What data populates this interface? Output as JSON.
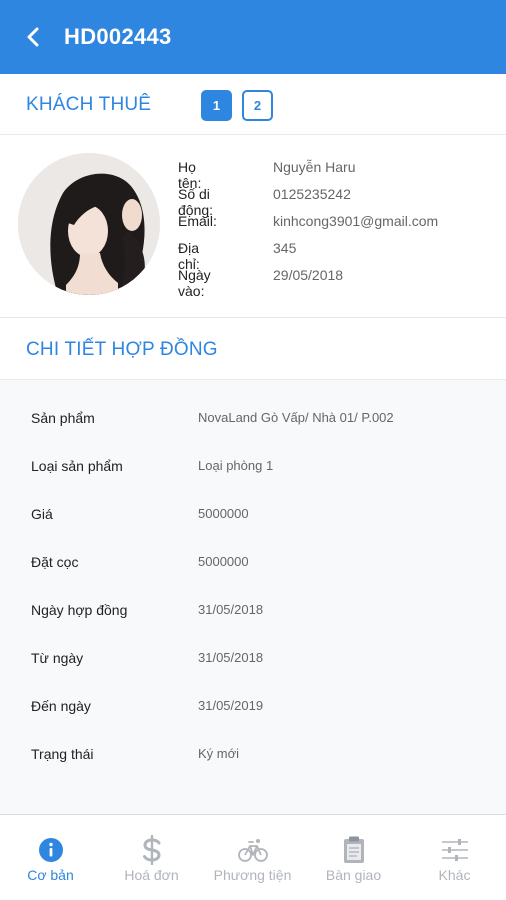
{
  "header": {
    "title": "HD002443"
  },
  "tenant": {
    "section_title": "KHÁCH THUÊ",
    "pages": [
      "1",
      "2"
    ],
    "fields": [
      {
        "label": "Họ tên:",
        "value": "Nguyễn Haru"
      },
      {
        "label": "Số di động:",
        "value": "0125235242"
      },
      {
        "label": "Email:",
        "value": "kinhcong3901@gmail.com"
      },
      {
        "label": "Địa chỉ:",
        "value": "345"
      },
      {
        "label": "Ngày vào:",
        "value": "29/05/2018"
      }
    ]
  },
  "contract": {
    "section_title": "CHI TIẾT HỢP ĐỒNG",
    "rows": [
      {
        "label": "Sản phẩm",
        "value": "NovaLand Gò Vấp/ Nhà 01/ P.002"
      },
      {
        "label": "Loại sản phẩm",
        "value": "Loại phòng 1"
      },
      {
        "label": "Giá",
        "value": "5000000"
      },
      {
        "label": "Đặt cọc",
        "value": "5000000"
      },
      {
        "label": "Ngày hợp đồng",
        "value": "31/05/2018"
      },
      {
        "label": "Từ ngày",
        "value": "31/05/2018"
      },
      {
        "label": "Đến ngày",
        "value": "31/05/2019"
      },
      {
        "label": "Trạng thái",
        "value": "Ký mới"
      }
    ]
  },
  "tabs": [
    {
      "label": "Cơ bản",
      "icon": "info-icon",
      "active": true
    },
    {
      "label": "Hoá đơn",
      "icon": "dollar-icon",
      "active": false
    },
    {
      "label": "Phương tiện",
      "icon": "bicycle-icon",
      "active": false
    },
    {
      "label": "Bàn giao",
      "icon": "clipboard-icon",
      "active": false
    },
    {
      "label": "Khác",
      "icon": "sliders-icon",
      "active": false
    }
  ],
  "colors": {
    "primary": "#2f86e0",
    "inactive": "#b0b5bc",
    "header_bg": "#2f86e0"
  }
}
